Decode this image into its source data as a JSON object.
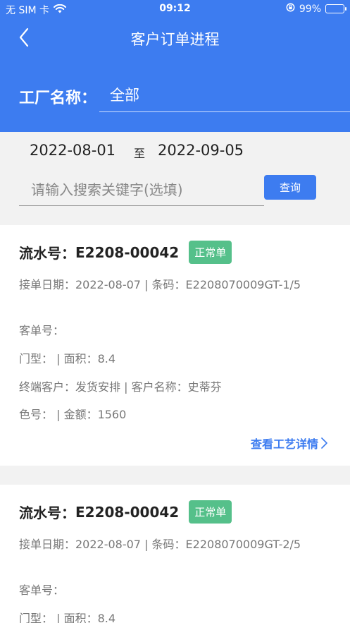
{
  "status_bar": {
    "carrier": "无 SIM 卡",
    "time": "09:12",
    "battery": "99%"
  },
  "nav": {
    "title": "客户订单进程"
  },
  "factory": {
    "label": "工厂名称：",
    "value": "全部"
  },
  "filter": {
    "date_start": "2022-08-01",
    "date_sep": "至",
    "date_end": "2022-09-05",
    "search_placeholder": "请输入搜索关键字(选填)",
    "query_label": "查询"
  },
  "orders": [
    {
      "serial_label": "流水号：",
      "serial": "E2208-00042",
      "status": "正常单",
      "line1": "接单日期：2022-08-07 | 条码：E2208070009GT-1/5",
      "line2": "客单号：",
      "line3": "门型： | 面积：8.4",
      "line4": "终端客户：发货安排 | 客户名称：史蒂芬",
      "line5": "色号： | 金额：1560",
      "detail_link": "查看工艺详情"
    },
    {
      "serial_label": "流水号：",
      "serial": "E2208-00042",
      "status": "正常单",
      "line1": "接单日期：2022-08-07 | 条码：E2208070009GT-2/5",
      "line2": "客单号：",
      "line3": "门型： | 面积：8.4"
    }
  ],
  "colors": {
    "primary": "#3d7cf0",
    "badge": "#55c08a",
    "background": "#f2f2f2"
  },
  "icons": [
    "wifi-icon",
    "battery-icon",
    "lock-rotation-icon",
    "back-arrow-icon",
    "chevron-right-icon"
  ]
}
